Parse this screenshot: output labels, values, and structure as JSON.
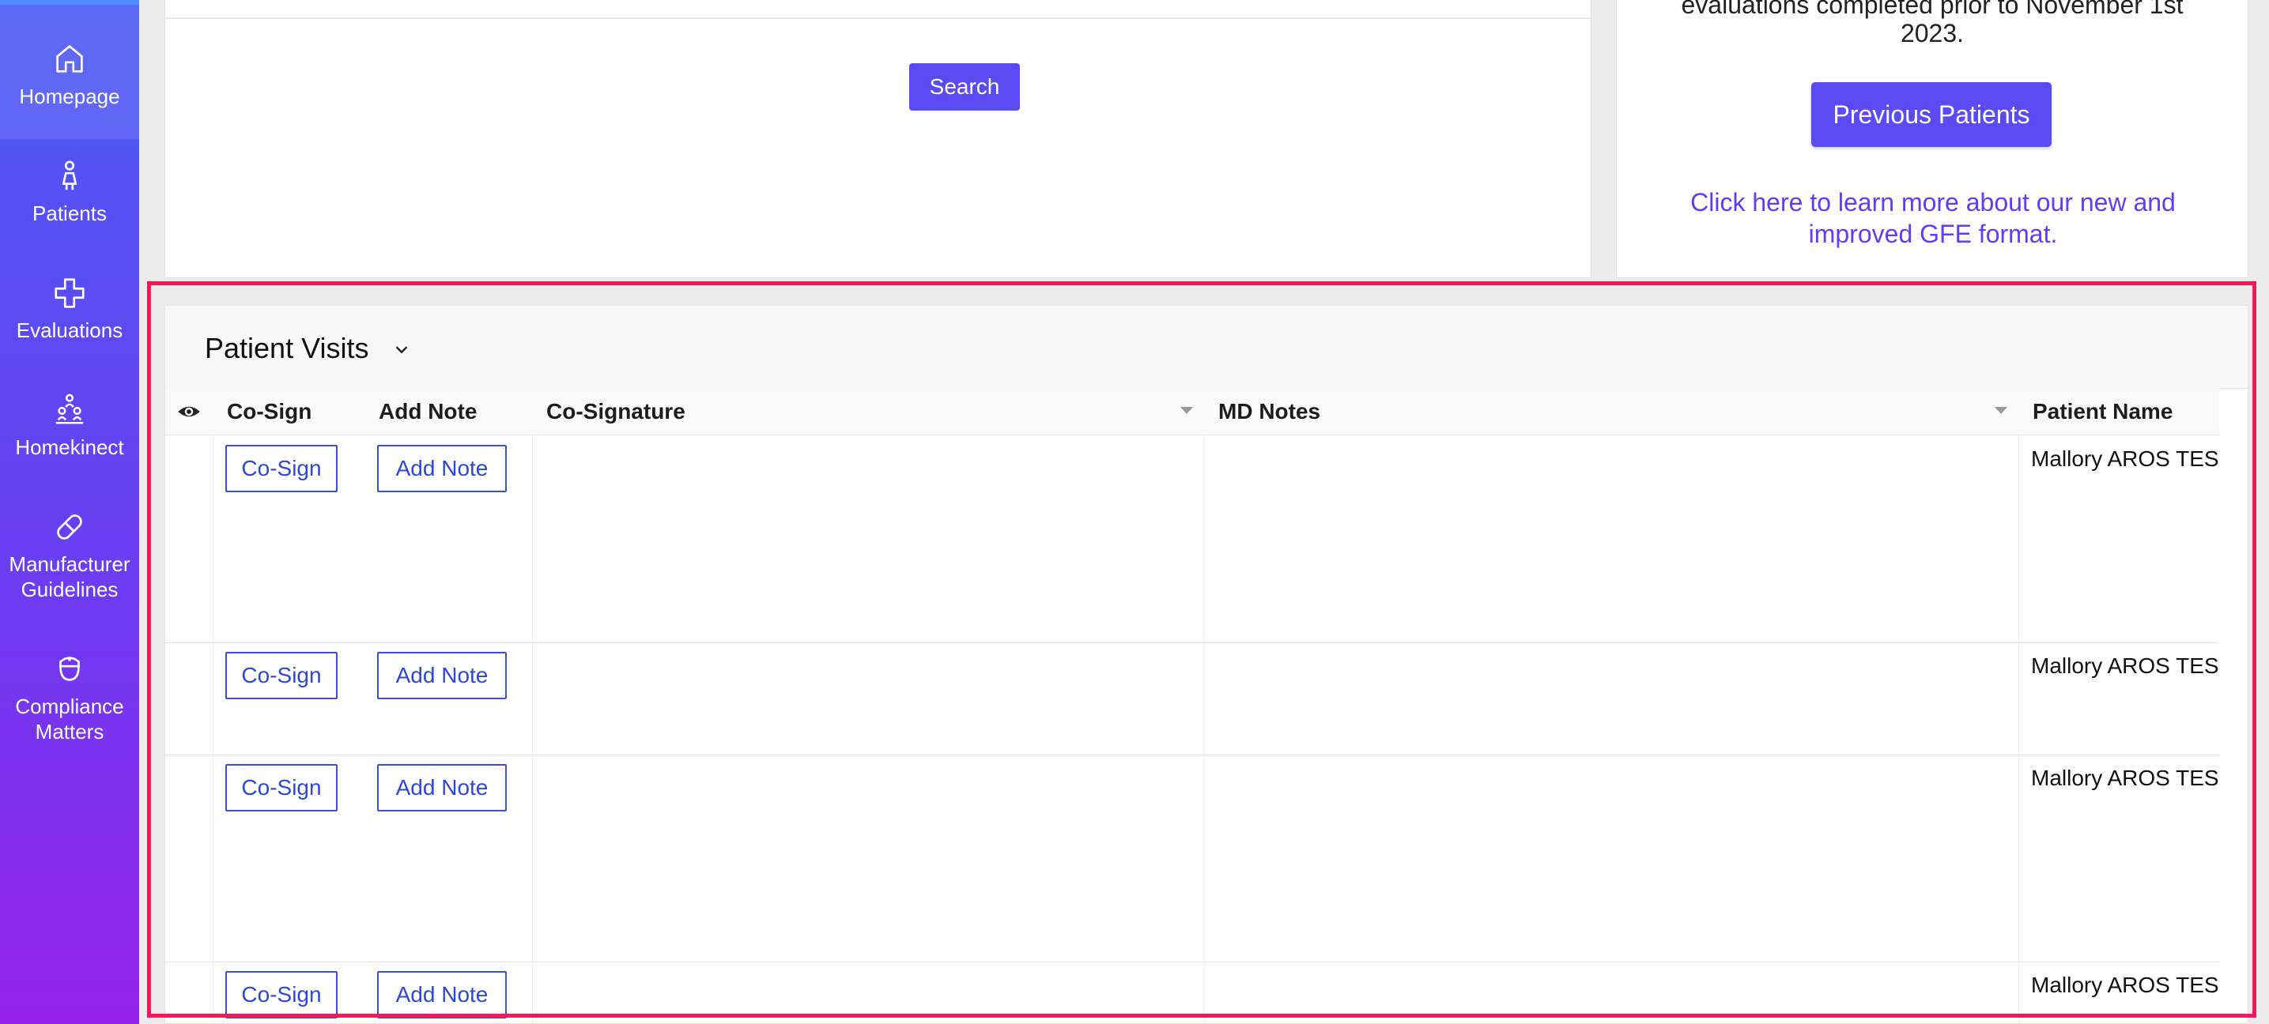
{
  "sidebar": {
    "items": [
      {
        "label": "Homepage",
        "icon": "home-icon"
      },
      {
        "label": "Patients",
        "icon": "patient-icon"
      },
      {
        "label": "Evaluations",
        "icon": "medical-cross-icon"
      },
      {
        "label": "Homekinect",
        "icon": "group-icon"
      },
      {
        "label": "Manufacturer Guidelines",
        "icon": "pill-icon"
      },
      {
        "label": "Compliance Matters",
        "icon": "nurse-icon"
      }
    ]
  },
  "search_card": {
    "search_label": "Search"
  },
  "previous_card": {
    "cut_text": "evaluations completed prior to November 1st",
    "year_text": "2023.",
    "previous_patients_label": "Previous Patients",
    "learn_more_link": "Click here to learn more about our new and improved GFE format."
  },
  "patient_visits": {
    "title": "Patient Visits",
    "columns": [
      "Co-Sign",
      "Add Note",
      "Co-Signature",
      "MD Notes",
      "Patient Name"
    ],
    "rows": [
      {
        "cosign": "Co-Sign",
        "add_note": "Add Note",
        "co_signature": "",
        "md_notes": "",
        "patient_name": "Mallory AROS TEST"
      },
      {
        "cosign": "Co-Sign",
        "add_note": "Add Note",
        "co_signature": "",
        "md_notes": "",
        "patient_name": "Mallory AROS TEST"
      },
      {
        "cosign": "Co-Sign",
        "add_note": "Add Note",
        "co_signature": "",
        "md_notes": "",
        "patient_name": "Mallory AROS TEST"
      },
      {
        "cosign": "Co-Sign",
        "add_note": "Add Note",
        "co_signature": "",
        "md_notes": "",
        "patient_name": "Mallory AROS TEST"
      }
    ]
  },
  "colors": {
    "primary": "#5a4bf5",
    "highlight": "#f01a5a",
    "link": "#5a3ff5"
  }
}
